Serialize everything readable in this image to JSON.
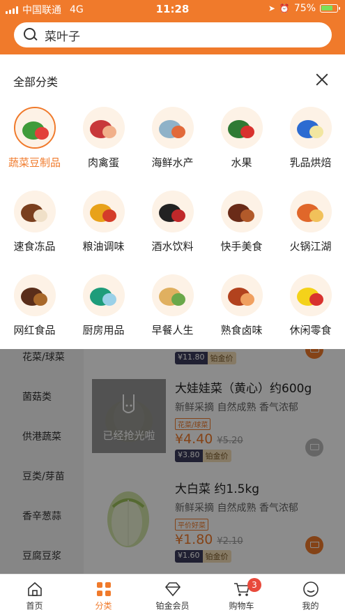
{
  "status_bar": {
    "carrier": "中国联通",
    "network": "4G",
    "time": "11:28",
    "battery": "75%",
    "battery_level": 0.75
  },
  "search": {
    "value": "菜叶子"
  },
  "panel": {
    "title": "全部分类",
    "categories": [
      {
        "label": "蔬菜豆制品",
        "icon": "vegetables-icon",
        "active": true
      },
      {
        "label": "肉禽蛋",
        "icon": "meat-icon"
      },
      {
        "label": "海鲜水产",
        "icon": "seafood-icon"
      },
      {
        "label": "水果",
        "icon": "fruit-icon"
      },
      {
        "label": "乳品烘焙",
        "icon": "dairy-icon"
      },
      {
        "label": "速食冻品",
        "icon": "frozen-food-icon"
      },
      {
        "label": "粮油调味",
        "icon": "grain-oil-icon"
      },
      {
        "label": "酒水饮料",
        "icon": "drinks-icon"
      },
      {
        "label": "快手美食",
        "icon": "quick-food-icon"
      },
      {
        "label": "火锅江湖",
        "icon": "hotpot-icon"
      },
      {
        "label": "网红食品",
        "icon": "snack-icon"
      },
      {
        "label": "厨房用品",
        "icon": "kitchen-icon"
      },
      {
        "label": "早餐人生",
        "icon": "breakfast-icon"
      },
      {
        "label": "熟食卤味",
        "icon": "cooked-food-icon"
      },
      {
        "label": "休闲零食",
        "icon": "chips-icon"
      }
    ]
  },
  "sidebar": {
    "items": [
      "花菜/球菜",
      "菌菇类",
      "供港蔬菜",
      "豆类/芽苗",
      "香辛葱蒜",
      "豆腐豆浆"
    ]
  },
  "products": [
    {
      "vip_price": "¥11.80",
      "vip_label": "铂金价"
    },
    {
      "title": "大娃娃菜（黄心）约600g",
      "desc": "新鲜采摘 自然成熟 香气浓郁",
      "tag": "花菜/球菜",
      "price": "¥4.40",
      "old_price": "¥5.20",
      "vip_price": "¥3.80",
      "vip_label": "铂金价",
      "sold_out": "已经抢光啦"
    },
    {
      "title": "大白菜 约1.5kg",
      "desc": "新鲜采摘 自然成熟 香气浓郁",
      "tag": "平价好菜",
      "price": "¥1.80",
      "old_price": "¥2.10",
      "vip_price": "¥1.60",
      "vip_label": "铂金价"
    }
  ],
  "tabbar": {
    "tabs": [
      {
        "label": "首页",
        "icon": "home-icon"
      },
      {
        "label": "分类",
        "icon": "category-icon",
        "active": true
      },
      {
        "label": "铂金会员",
        "icon": "diamond-icon"
      },
      {
        "label": "购物车",
        "icon": "cart-icon"
      },
      {
        "label": "我的",
        "icon": "profile-icon"
      }
    ],
    "cart_badge": "3"
  },
  "colors": {
    "accent": "#F07A2B",
    "badge": "#e84a3c"
  }
}
